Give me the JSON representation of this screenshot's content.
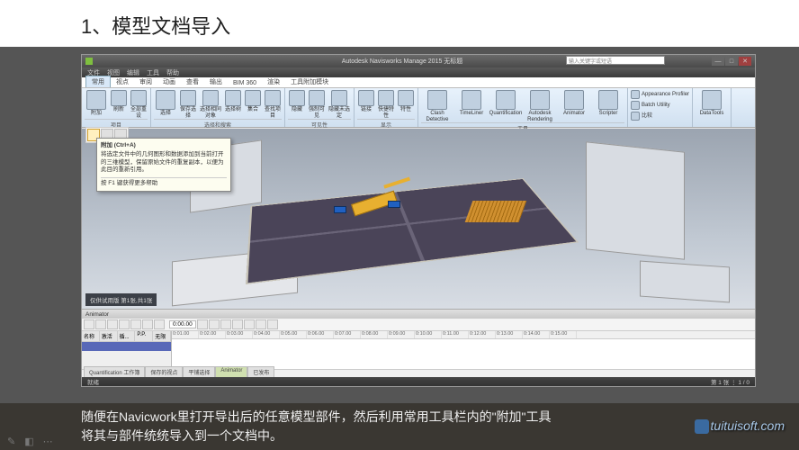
{
  "slide": {
    "title": "1、模型文档导入"
  },
  "titlebar": {
    "app_title": "Autodesk Navisworks Manage 2015 无标题",
    "search_placeholder": "输入关键字或短语",
    "min": "—",
    "max": "□",
    "close": "✕"
  },
  "menubar": [
    "文件",
    "视图",
    "编辑",
    "工具",
    "帮助"
  ],
  "ribbon_tabs": [
    "常用",
    "视点",
    "审阅",
    "动画",
    "查看",
    "输出",
    "BIM 360",
    "渲染",
    "工具附加模块"
  ],
  "ribbon_active_tab": "常用",
  "ribbon_groups": [
    {
      "label": "项目",
      "buttons": [
        "附加",
        "刷新",
        "全部重设"
      ]
    },
    {
      "label": "选择和搜索",
      "buttons": [
        "选择",
        "保存选择",
        "选择相同对象",
        "选择树",
        "集合",
        "查找项目"
      ]
    },
    {
      "label": "可见性",
      "buttons": [
        "隐藏",
        "强制可见",
        "隐藏未选定"
      ]
    },
    {
      "label": "显示",
      "buttons": [
        "链接",
        "快捷特性",
        "特性"
      ]
    },
    {
      "label": "工具",
      "buttons": [
        "Clash Detective",
        "TimeLiner",
        "Quantification",
        "Autodesk Rendering",
        "Animator",
        "Scripter",
        "Appearance Profiler",
        "Batch Utility",
        "比较",
        "DataTools"
      ]
    }
  ],
  "tooltip": {
    "title": "附加 (Ctrl+A)",
    "body": "将选定文件中的几何图形和数据添加到当前打开的三维模型，保留原始文件的重复副本，以便为此目的重新引用。",
    "foot": "按 F1 键获得更多帮助"
  },
  "viewport": {
    "status": "仅供试用版 第1张,共1张"
  },
  "animator": {
    "title": "Animator",
    "timecode": "0:00.00",
    "cols": [
      "名称",
      "激活",
      "循...",
      "P.P.",
      "无限"
    ],
    "ruler": [
      "0:01.00",
      "0:02.00",
      "0:03.00",
      "0:04.00",
      "0:05.00",
      "0:06.00",
      "0:07.00",
      "0:08.00",
      "0:09.00",
      "0:10.00",
      "0:11.00",
      "0:12.00",
      "0:13.00",
      "0:14.00",
      "0:15.00"
    ]
  },
  "bottom_tabs": [
    "Quantification 工作簿",
    "保存的视点",
    "平铺选择",
    "Animator",
    "已发布"
  ],
  "bottom_tabs_active": "Animator",
  "statusbar": {
    "left": "就绪",
    "right": "第 1 张 ⋮ 1 / 0"
  },
  "caption": {
    "line1": "随便在Navicwork里打开导出后的任意模型部件，然后利用常用工具栏内的\"附加\"工具",
    "line2": "将其与部件统统导入到一个文档中。"
  },
  "watermark": "tuituisoft.com"
}
